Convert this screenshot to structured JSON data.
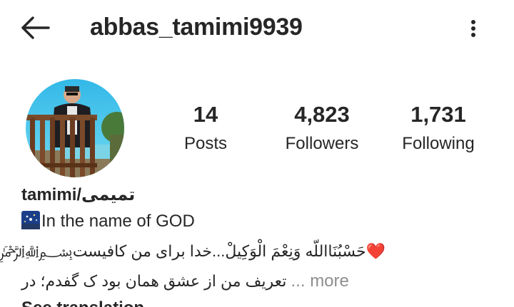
{
  "header": {
    "username": "abbas_tamimi9939",
    "back_icon": "arrow-left-icon",
    "menu_icon": "more-vertical-icon"
  },
  "stats": {
    "posts": {
      "value": "14",
      "label": "Posts"
    },
    "followers": {
      "value": "4,823",
      "label": "Followers"
    },
    "following": {
      "value": "1,731",
      "label": "Following"
    }
  },
  "bio": {
    "display_name": "tamimi/تمیمی",
    "line1_emoji": "night-with-stars-emoji",
    "line1": "In the name of GOD",
    "line2": "❤️حَسْبُنَااللّه وَنِعْمَ الْوَكِيلْ...خدا برای من کافیست﷽",
    "line3": "تعریف من از عشق همان بود ک گفدم؛ در",
    "more_label": "... more",
    "see_translation": "See translation"
  },
  "colors": {
    "text": "#262626",
    "muted": "#8e8e8e",
    "background": "#ffffff"
  }
}
